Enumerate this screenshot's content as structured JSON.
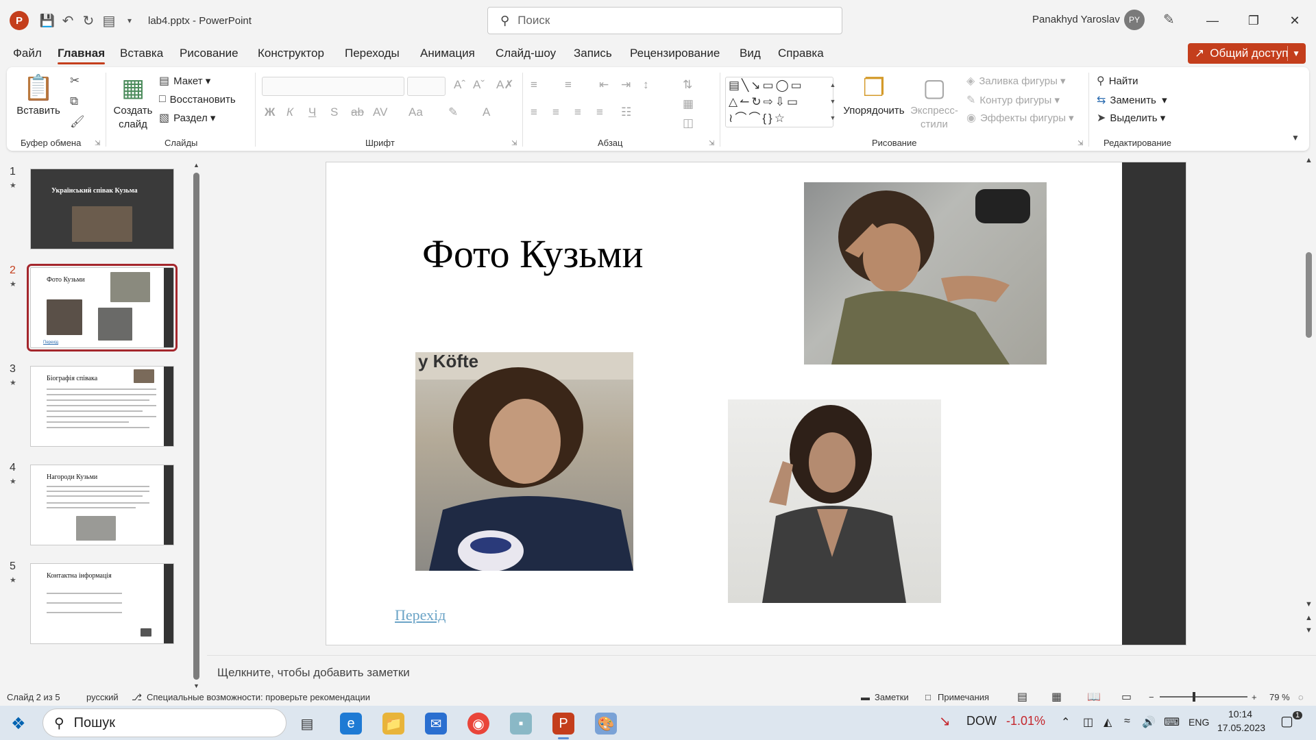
{
  "window": {
    "doc_title": "lab4.pptx - PowerPoint",
    "search_placeholder": "Поиск",
    "user_name": "Panakhyd Yaroslav",
    "user_initials": "PY",
    "accent_color": "#c43e1c"
  },
  "menu": {
    "tabs": [
      "Файл",
      "Главная",
      "Вставка",
      "Рисование",
      "Конструктор",
      "Переходы",
      "Анимация",
      "Слайд-шоу",
      "Запись",
      "Рецензирование",
      "Вид",
      "Справка"
    ],
    "active_tab": "Главная",
    "share_label": "Общий доступ"
  },
  "ribbon": {
    "clipboard": {
      "paste": "Вставить",
      "group": "Буфер обмена"
    },
    "slides": {
      "new_slide": "Создать слайд",
      "layout": "Макет",
      "reset": "Восстановить",
      "section": "Раздел",
      "group": "Слайды"
    },
    "font": {
      "group": "Шрифт",
      "bold": "Ж",
      "italic": "К",
      "underline": "Ч",
      "shadow": "S",
      "strike": "ab",
      "spacing": "AV",
      "case": "Aa"
    },
    "paragraph": {
      "group": "Абзац"
    },
    "drawing": {
      "arrange": "Упорядочить",
      "quick_styles": "Экспресс-стили",
      "fill": "Заливка фигуры",
      "outline": "Контур фигуры",
      "effects": "Эффекты фигуры",
      "group": "Рисование"
    },
    "editing": {
      "find": "Найти",
      "replace": "Заменить",
      "select": "Выделить",
      "group": "Редактирование"
    }
  },
  "thumbnails": [
    {
      "num": "1",
      "title": "Український співак Кузьма"
    },
    {
      "num": "2",
      "title": "Фото Кузьми",
      "link": "Перехід"
    },
    {
      "num": "3",
      "title": "Біографія співака"
    },
    {
      "num": "4",
      "title": "Нагороди Кузьми"
    },
    {
      "num": "5",
      "title": "Контактна інформація"
    }
  ],
  "slide": {
    "title": "Фото Кузьми",
    "link": "Перехід"
  },
  "notes_placeholder": "Щелкните, чтобы добавить заметки",
  "status": {
    "slide_info": "Слайд 2 из 5",
    "language": "русский",
    "accessibility": "Специальные возможности: проверьте рекомендации",
    "notes": "Заметки",
    "comments": "Примечания",
    "zoom": "79 %"
  },
  "taskbar": {
    "search": "Пошук",
    "stock_name": "DOW",
    "stock_change": "-1.01%",
    "lang": "ENG",
    "time": "10:14",
    "date": "17.05.2023",
    "notifications": "1"
  }
}
